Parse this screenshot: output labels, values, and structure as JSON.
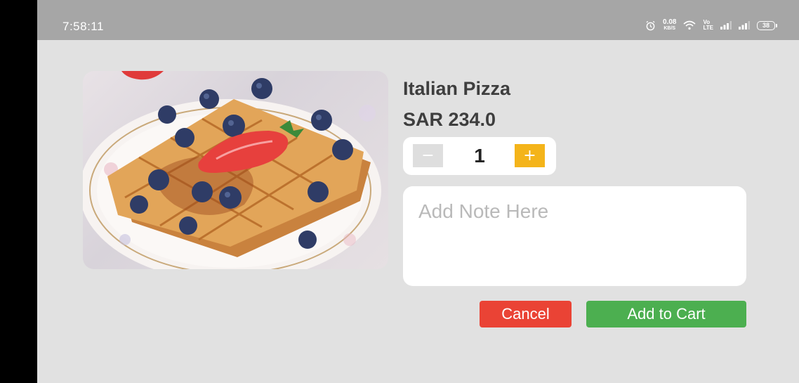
{
  "status_bar": {
    "time": "7:58:11",
    "net_speed_value": "0.08",
    "net_speed_unit": "KB/S",
    "volte_top": "Vo",
    "volte_bottom": "LTE",
    "battery": "38",
    "icons": [
      "alarm-icon",
      "wifi-icon",
      "volte-icon",
      "signal-icon",
      "signal-icon",
      "battery-icon"
    ]
  },
  "product": {
    "image_icon": "food-photo-waffles",
    "name": "Italian Pizza",
    "price": "SAR 234.0"
  },
  "quantity": {
    "minus_label": "−",
    "value": "1",
    "plus_label": "+"
  },
  "note": {
    "placeholder": "Add Note Here",
    "value": ""
  },
  "actions": {
    "cancel_label": "Cancel",
    "add_to_cart_label": "Add to Cart"
  },
  "colors": {
    "cancel": "#ea4335",
    "add_to_cart": "#4caf50",
    "plus": "#f4b41a",
    "minus": "#dedede",
    "status_bar": "#a6a6a6",
    "background": "#e1e1e1"
  }
}
